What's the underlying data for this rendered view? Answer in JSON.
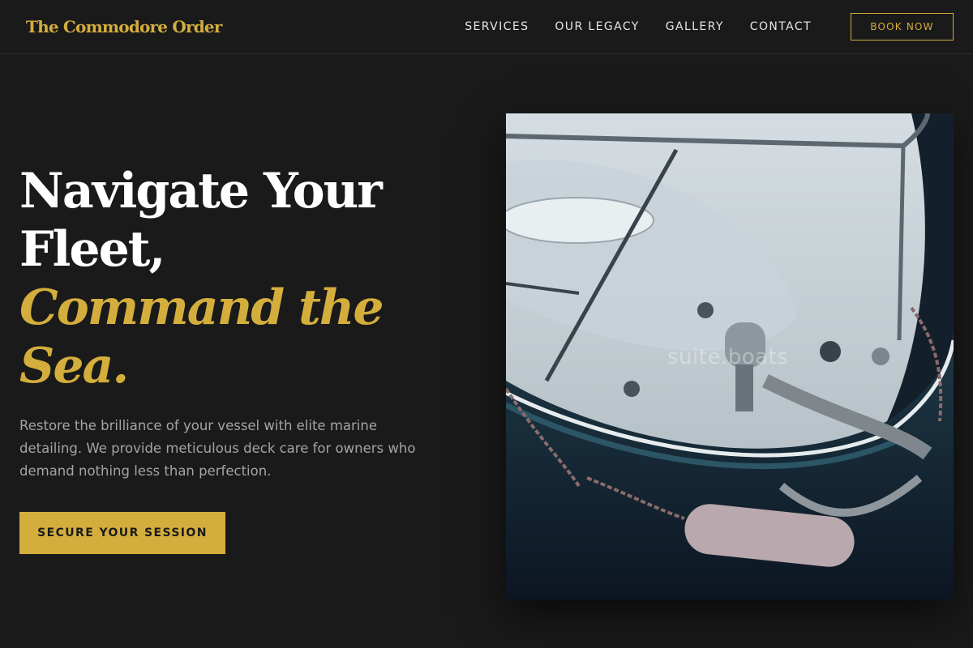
{
  "brand": {
    "name": "The Commodore Order"
  },
  "nav": {
    "links": [
      "SERVICES",
      "OUR LEGACY",
      "GALLERY",
      "CONTACT"
    ],
    "cta_label": "BOOK NOW"
  },
  "hero": {
    "headline_line1": "Navigate Your",
    "headline_line2": "Fleet,",
    "headline_accent_line1": "Command the",
    "headline_accent_line2": "Sea.",
    "subtext": "Restore the brilliance of your vessel with elite marine detailing. We provide meticulous deck care for owners who demand nothing less than perfection.",
    "cta_label": "SECURE YOUR SESSION",
    "image_watermark": "suite.boats"
  },
  "colors": {
    "background": "#1a1a1b",
    "accent": "#d4ae3c",
    "text_primary": "#ffffff",
    "text_muted": "#a4a4a8"
  }
}
